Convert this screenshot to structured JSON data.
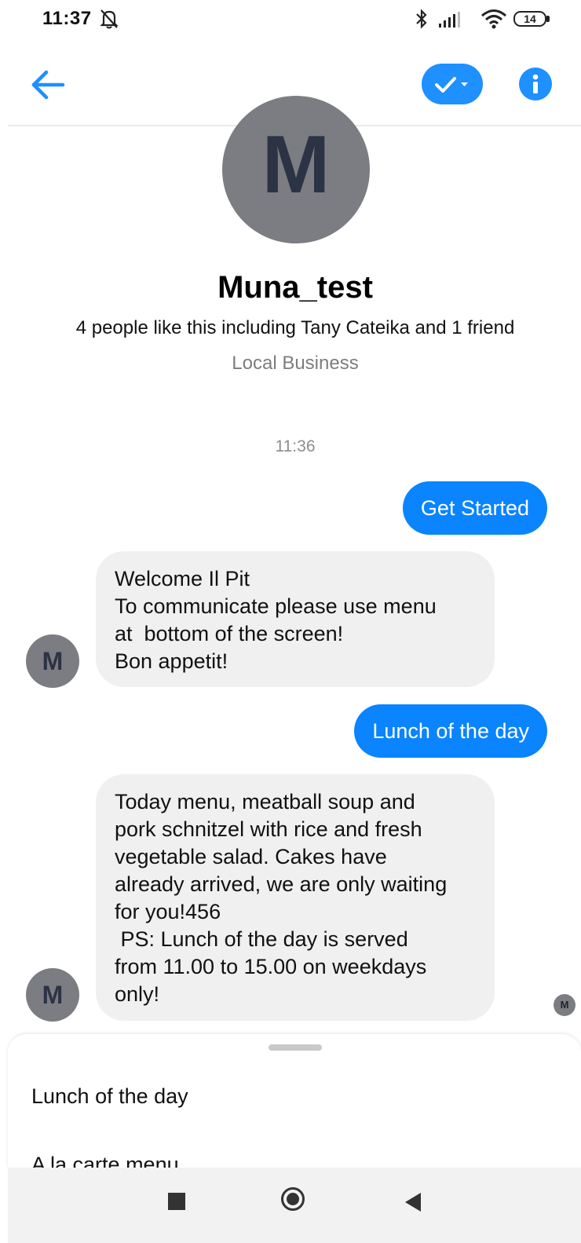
{
  "status_bar": {
    "time": "11:37",
    "battery": "14",
    "icons": [
      "mute-alarm-icon",
      "bluetooth-icon",
      "signal-icon",
      "wifi-icon",
      "battery-icon"
    ]
  },
  "header": {
    "icons": [
      "back-arrow-icon",
      "check-dropdown-icon",
      "info-icon"
    ],
    "accent_color": "#1e90ff"
  },
  "profile": {
    "avatar_letter": "M",
    "name": "Muna_test",
    "likes": "4 people like this including Tany Cateika and 1 friend",
    "category": "Local Business"
  },
  "conversation": {
    "timestamp": "11:36",
    "messages": [
      {
        "from": "user",
        "text": "Get Started"
      },
      {
        "from": "page",
        "avatar_letter": "M",
        "lines": [
          "Welcome Il Pit",
          "To communicate please use menu",
          "at  bottom of the screen!",
          "Bon appetit!"
        ]
      },
      {
        "from": "user",
        "text": "Lunch of the day"
      },
      {
        "from": "page",
        "avatar_letter": "M",
        "lines": [
          "Today menu, meatball soup and",
          "pork schnitzel with rice and fresh",
          "vegetable salad. Cakes have",
          "already arrived, we are only waiting",
          "for you!456",
          " PS: Lunch of the day is served",
          "from 11.00 to 15.00 on weekdays",
          "only!"
        ]
      }
    ],
    "seen_avatar_letter": "M",
    "outgoing_color": "#0a84ff",
    "incoming_color": "#f0f0f0"
  },
  "menu_sheet": {
    "items": [
      "Lunch of the day",
      "A la carte menu"
    ]
  },
  "nav_bar": {
    "icons": [
      "recent-apps-icon",
      "home-icon",
      "back-icon"
    ]
  }
}
